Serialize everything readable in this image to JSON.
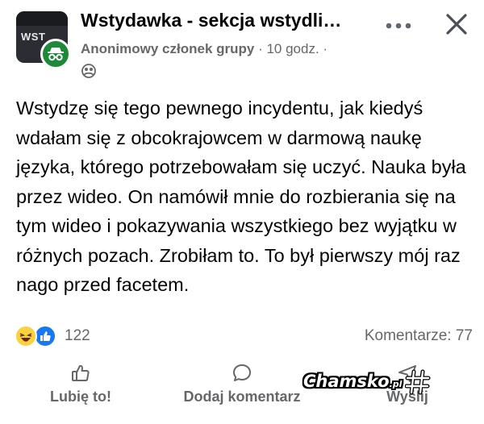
{
  "header": {
    "group_title": "Wstydawka - sekcja wstydli…",
    "group_avatar_text": "WST",
    "author": "Anonimowy członek grupy",
    "separator": " · ",
    "time": "10 godz.",
    "trailing_dot": " ·"
  },
  "post": {
    "text": "Wstydzę się tego pewnego incydentu, jak kiedyś wdałam się z obcokrajowcem w darmową naukę języka, którego potrzebowałam się uczyć. Nauka była przez wideo. On namówił mnie do rozbierania się na tym wideo i pokazywania wszystkiego bez wyjątku w różnych pozach. Zrobiłam to. To był pierwszy mój raz nago przed facetem."
  },
  "reactions": {
    "icons": [
      "haha-reaction-icon",
      "like-reaction-icon"
    ],
    "count": "122",
    "comments": "Komentarze: 77"
  },
  "actions": {
    "like": "Lubię to!",
    "comment": "Dodaj komentarz",
    "send": "Wyślij"
  },
  "watermark": {
    "text": "Chamsko",
    "suffix": ".pl"
  },
  "colors": {
    "secondary_text": "#65676b",
    "like_blue": "#1877f2",
    "haha_yellow": "#fcd13f",
    "anon_green": "#1d8a3a"
  }
}
